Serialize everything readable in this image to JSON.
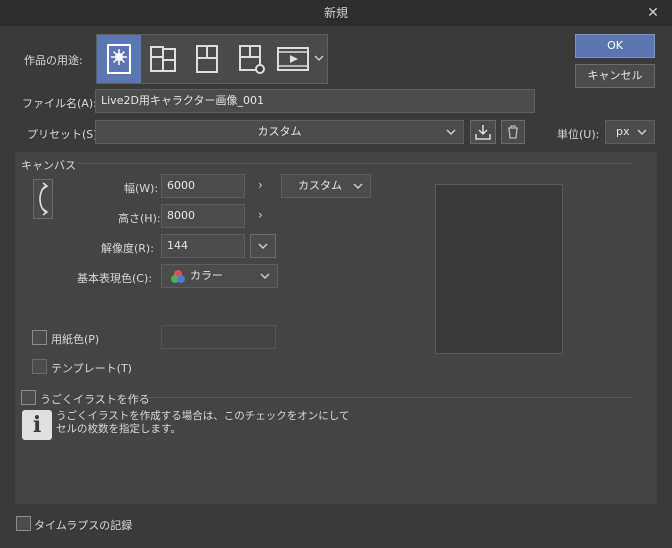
{
  "window": {
    "title": "新規",
    "close_glyph": "✕"
  },
  "purpose": {
    "label": "作品の用途:",
    "icons": [
      {
        "name": "illustration-purpose-icon",
        "selected": true
      },
      {
        "name": "comic-purpose-icon",
        "selected": false
      },
      {
        "name": "comic-page-purpose-icon",
        "selected": false
      },
      {
        "name": "comic-settings-purpose-icon",
        "selected": false
      },
      {
        "name": "animation-purpose-icon",
        "selected": false
      }
    ]
  },
  "buttons": {
    "ok": "OK",
    "cancel": "キャンセル"
  },
  "filename": {
    "label": "ファイル名(A):",
    "value": "Live2D用キャラクター画像_001"
  },
  "preset": {
    "label": "プリセット(S):",
    "value": "カスタム"
  },
  "unit": {
    "label": "単位(U):",
    "value": "px"
  },
  "canvas": {
    "section_label": "キャンバス",
    "width_label": "幅(W):",
    "width_value": "6000",
    "height_label": "高さ(H):",
    "height_value": "8000",
    "size_preset": "カスタム",
    "resolution_label": "解像度(R):",
    "resolution_value": "144",
    "color_label": "基本表現色(C):",
    "color_value": "カラー",
    "paper_color_label": "用紙色(P)",
    "template_label": "テンプレート(T)"
  },
  "animated": {
    "label": "うごくイラストを作る",
    "info_text_line1": "うごくイラストを作成する場合は、このチェックをオンにして",
    "info_text_line2": "セルの枚数を指定します。"
  },
  "timelapse": {
    "label": "タイムラプスの記録"
  },
  "colors": {
    "accent": "#5b76b0",
    "bg": "#3a3a3a",
    "panel": "#444444"
  }
}
